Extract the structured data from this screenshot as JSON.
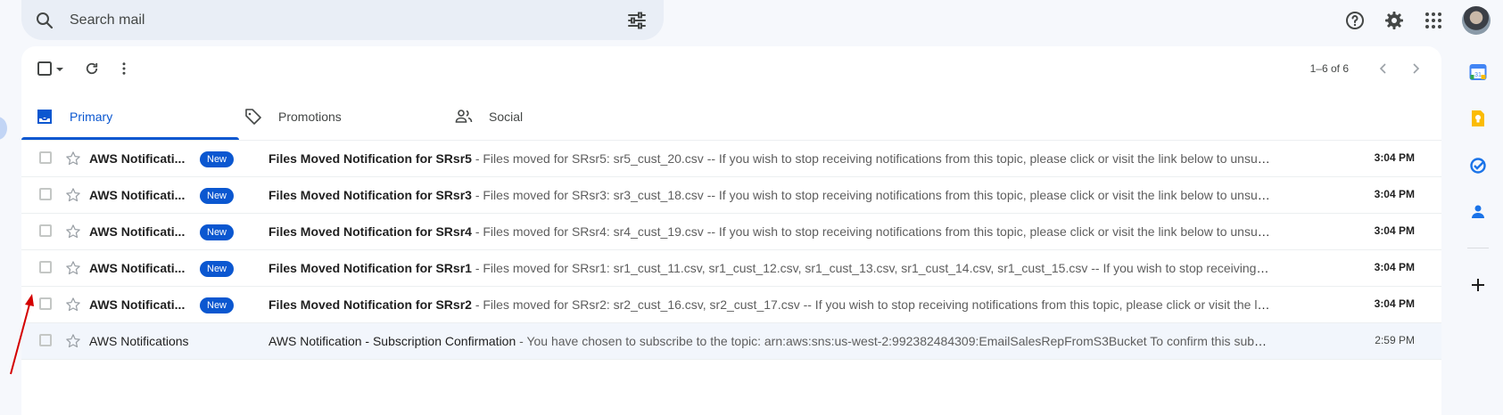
{
  "search": {
    "placeholder": "Search mail"
  },
  "header_icons": [
    "help-icon",
    "settings-gear-icon",
    "apps-grid-icon",
    "account-avatar"
  ],
  "toolbar": {
    "page_count": "1–6 of 6"
  },
  "tabs": [
    {
      "label": "Primary",
      "icon": "inbox-icon",
      "active": true
    },
    {
      "label": "Promotions",
      "icon": "tag-icon",
      "active": false
    },
    {
      "label": "Social",
      "icon": "people-icon",
      "active": false
    }
  ],
  "emails": [
    {
      "sender": "AWS Notificati...",
      "badge": "New",
      "subject_prefix": "Files Moved Notification for ",
      "subject_highlight": "SRsr5",
      "snippet": " - Files moved for SRsr5: sr5_cust_20.csv -- If you wish to stop receiving notifications from this topic, please click or visit the link below to unsubscribe: ...",
      "time": "3:04 PM",
      "unread": true
    },
    {
      "sender": "AWS Notificati...",
      "badge": "New",
      "subject_prefix": "Files Moved Notification for ",
      "subject_highlight": "SRsr3",
      "snippet": " - Files moved for SRsr3: sr3_cust_18.csv -- If you wish to stop receiving notifications from this topic, please click or visit the link below to unsubscribe: h...",
      "time": "3:04 PM",
      "unread": true
    },
    {
      "sender": "AWS Notificati...",
      "badge": "New",
      "subject_prefix": "Files Moved Notification for ",
      "subject_highlight": "SRsr4",
      "snippet": " - Files moved for SRsr4: sr4_cust_19.csv -- If you wish to stop receiving notifications from this topic, please click or visit the link below to unsubscribe: h...",
      "time": "3:04 PM",
      "unread": true
    },
    {
      "sender": "AWS Notificati...",
      "badge": "New",
      "subject_prefix": "Files Moved Notification for ",
      "subject_highlight": "SRsr1",
      "snippet": " - Files moved for SRsr1: sr1_cust_11.csv, sr1_cust_12.csv, sr1_cust_13.csv, sr1_cust_14.csv, sr1_cust_15.csv -- If you wish to stop receiving notifications fro...",
      "time": "3:04 PM",
      "unread": true
    },
    {
      "sender": "AWS Notificati...",
      "badge": "New",
      "subject_prefix": "Files Moved Notification for ",
      "subject_highlight": "SRsr2",
      "snippet": " - Files moved for SRsr2: sr2_cust_16.csv, sr2_cust_17.csv -- If you wish to stop receiving notifications from this topic, please click or visit the link below t...",
      "time": "3:04 PM",
      "unread": true
    },
    {
      "sender": "AWS Notifications",
      "badge": "",
      "subject_prefix": "AWS Notification - Subscription Confirmation",
      "subject_highlight": "",
      "snippet": " - You have chosen to subscribe to the topic: arn:aws:sns:us-west-2:992382484309:EmailSalesRepFromS3Bucket To confirm this subscription, ...",
      "time": "2:59 PM",
      "unread": false
    }
  ],
  "side_rail": {
    "calendar_day": "31",
    "items": [
      "calendar-icon",
      "keep-icon",
      "tasks-icon",
      "contacts-icon",
      "add-icon"
    ]
  },
  "colors": {
    "accent": "#0b57d0",
    "highlight": "#d40000",
    "background": "#f6f8fc"
  }
}
